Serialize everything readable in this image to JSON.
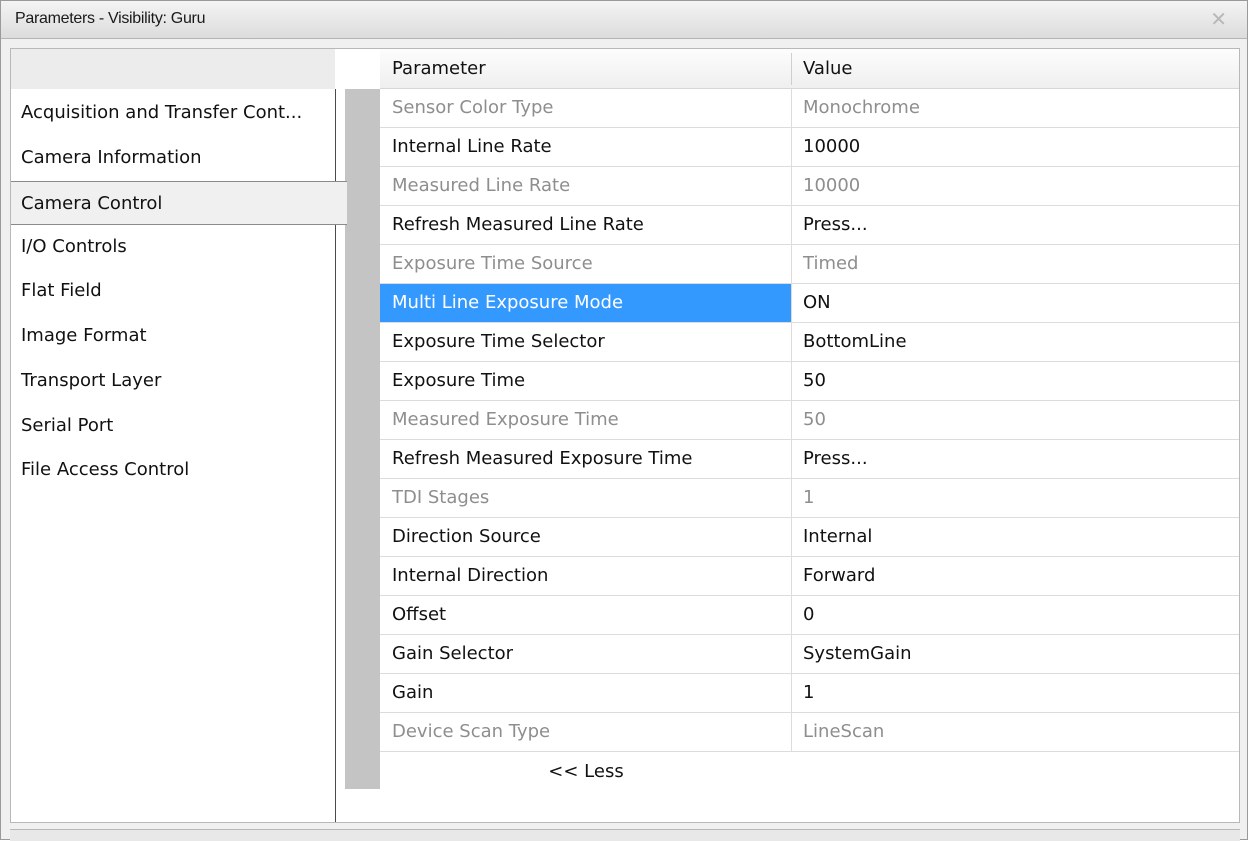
{
  "window": {
    "title": "Parameters - Visibility: Guru",
    "close_icon": "close-icon"
  },
  "sidebar": {
    "items": [
      {
        "label": "Acquisition and Transfer Cont..."
      },
      {
        "label": "Camera Information"
      },
      {
        "label": "Camera Control",
        "selected": true
      },
      {
        "label": "I/O Controls"
      },
      {
        "label": "Flat Field"
      },
      {
        "label": "Image Format"
      },
      {
        "label": "Transport Layer"
      },
      {
        "label": "Serial Port"
      },
      {
        "label": "File Access Control"
      }
    ]
  },
  "grid": {
    "headers": {
      "parameter": "Parameter",
      "value": "Value"
    },
    "rows": [
      {
        "parameter": "Sensor Color Type",
        "value": "Monochrome",
        "enabled": false
      },
      {
        "parameter": "Internal Line Rate",
        "value": "10000",
        "enabled": true
      },
      {
        "parameter": "Measured Line Rate",
        "value": "10000",
        "enabled": false
      },
      {
        "parameter": "Refresh Measured Line Rate",
        "value": "Press...",
        "enabled": true
      },
      {
        "parameter": "Exposure Time Source",
        "value": "Timed",
        "enabled": false
      },
      {
        "parameter": "Multi Line Exposure Mode",
        "value": "ON",
        "enabled": true,
        "selected": true
      },
      {
        "parameter": "Exposure Time Selector",
        "value": "BottomLine",
        "enabled": true
      },
      {
        "parameter": "Exposure Time",
        "value": "50",
        "enabled": true
      },
      {
        "parameter": "Measured Exposure Time",
        "value": "50",
        "enabled": false
      },
      {
        "parameter": "Refresh Measured Exposure Time",
        "value": "Press...",
        "enabled": true
      },
      {
        "parameter": "TDI Stages",
        "value": "1",
        "enabled": false
      },
      {
        "parameter": "Direction Source",
        "value": "Internal",
        "enabled": true
      },
      {
        "parameter": "Internal Direction",
        "value": "Forward",
        "enabled": true
      },
      {
        "parameter": "Offset",
        "value": "0",
        "enabled": true
      },
      {
        "parameter": "Gain Selector",
        "value": "SystemGain",
        "enabled": true
      },
      {
        "parameter": "Gain",
        "value": "1",
        "enabled": true
      },
      {
        "parameter": "Device Scan Type",
        "value": "LineScan",
        "enabled": false
      }
    ],
    "less_label": "<< Less"
  },
  "colors": {
    "selection": "#3399ff",
    "disabled_text": "#8e8e8e",
    "gutter": "#c4c4c4"
  }
}
